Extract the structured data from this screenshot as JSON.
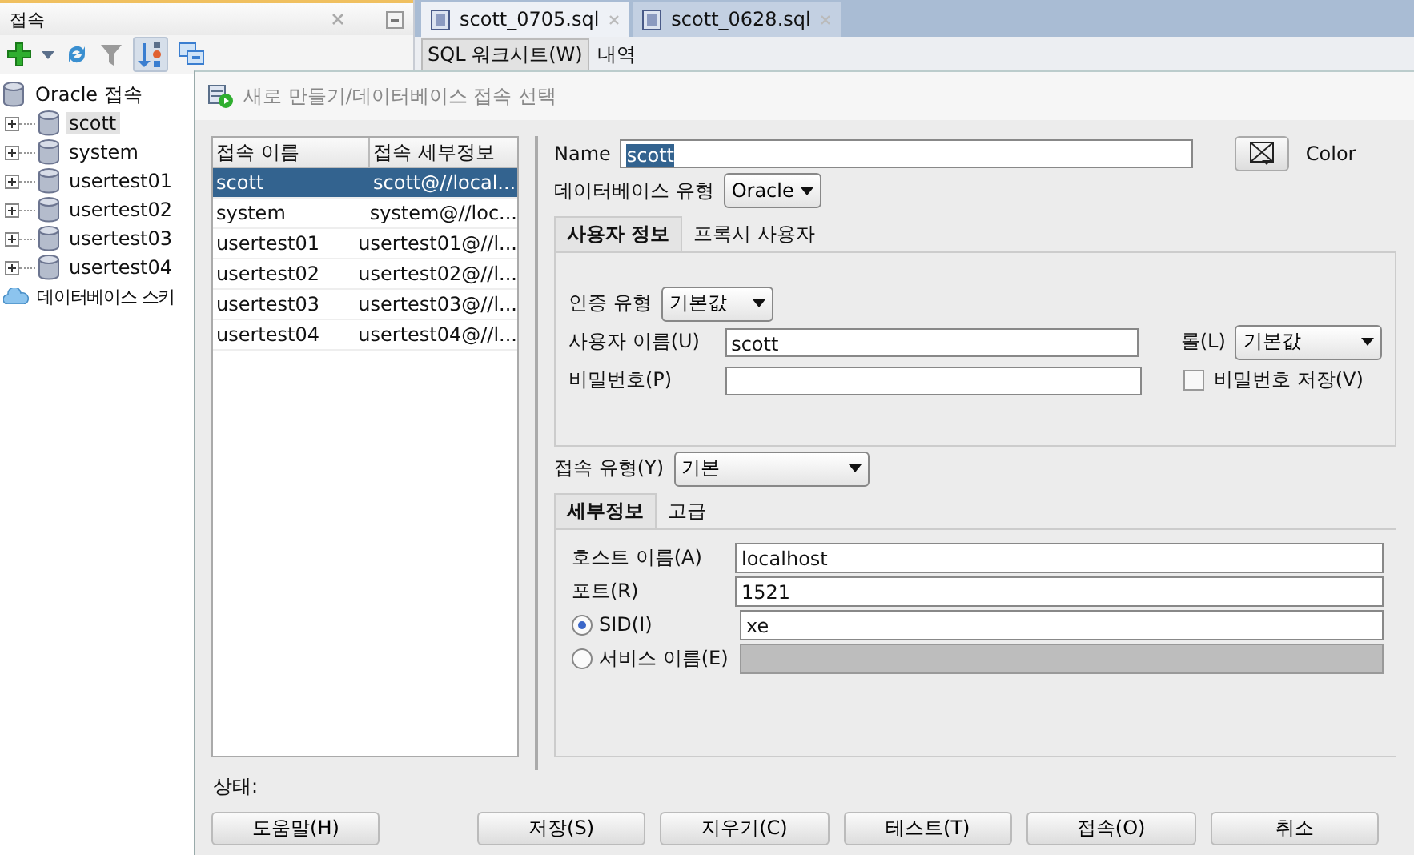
{
  "sidebar": {
    "title": "접속",
    "tree": [
      {
        "label": "Oracle 접속",
        "children": [
          {
            "label": "scott",
            "selected": true,
            "expanded": false
          },
          {
            "label": "system",
            "selected": false,
            "expanded": false
          },
          {
            "label": "usertest01",
            "selected": false,
            "expanded": false
          },
          {
            "label": "usertest02",
            "selected": false,
            "expanded": false
          },
          {
            "label": "usertest03",
            "selected": false,
            "expanded": false
          },
          {
            "label": "usertest04",
            "selected": false,
            "expanded": false
          }
        ]
      },
      {
        "label": "데이터베이스 스키",
        "kind": "cloud"
      }
    ]
  },
  "editor_tabs": [
    {
      "label": "scott_0705.sql",
      "selected": true
    },
    {
      "label": "scott_0628.sql",
      "selected": false
    }
  ],
  "editor_subtabs": [
    {
      "label": "SQL 워크시트(W)",
      "selected": true
    },
    {
      "label": "내역",
      "selected": false
    }
  ],
  "dialog": {
    "title": "새로 만들기/데이터베이스 접속 선택",
    "connections": {
      "columns": [
        "접속 이름",
        "접속 세부정보"
      ],
      "rows": [
        {
          "name": "scott",
          "details": "scott@//local...",
          "selected": true
        },
        {
          "name": "system",
          "details": "system@//loc...",
          "selected": false
        },
        {
          "name": "usertest01",
          "details": "usertest01@//l...",
          "selected": false
        },
        {
          "name": "usertest02",
          "details": "usertest02@//l...",
          "selected": false
        },
        {
          "name": "usertest03",
          "details": "usertest03@//l...",
          "selected": false
        },
        {
          "name": "usertest04",
          "details": "usertest04@//l...",
          "selected": false
        }
      ]
    },
    "name": {
      "label": "Name",
      "value": "scott"
    },
    "color_label": "Color",
    "db_type": {
      "label": "데이터베이스 유형",
      "value": "Oracle"
    },
    "user_tabs": [
      {
        "label": "사용자 정보",
        "selected": true
      },
      {
        "label": "프록시 사용자",
        "selected": false
      }
    ],
    "auth_type": {
      "label": "인증 유형",
      "value": "기본값"
    },
    "username": {
      "label": "사용자 이름(U)",
      "value": "scott"
    },
    "role": {
      "label": "롤(L)",
      "value": "기본값"
    },
    "password": {
      "label": "비밀번호(P)"
    },
    "save_password": {
      "label": "비밀번호 저장(V)",
      "checked": false
    },
    "connection_type": {
      "label": "접속 유형(Y)",
      "value": "기본"
    },
    "detail_tabs": [
      {
        "label": "세부정보",
        "selected": true
      },
      {
        "label": "고급",
        "selected": false
      }
    ],
    "host": {
      "label": "호스트 이름(A)",
      "value": "localhost"
    },
    "port": {
      "label": "포트(R)",
      "value": "1521"
    },
    "sid": {
      "label": "SID(I)",
      "value": "xe",
      "selected": true
    },
    "service": {
      "label": "서비스 이름(E)",
      "selected": false
    },
    "status_label": "상태:",
    "help_button": "도움말(H)",
    "buttons": [
      "저장(S)",
      "지우기(C)",
      "테스트(T)",
      "접속(O)",
      "취소"
    ]
  }
}
